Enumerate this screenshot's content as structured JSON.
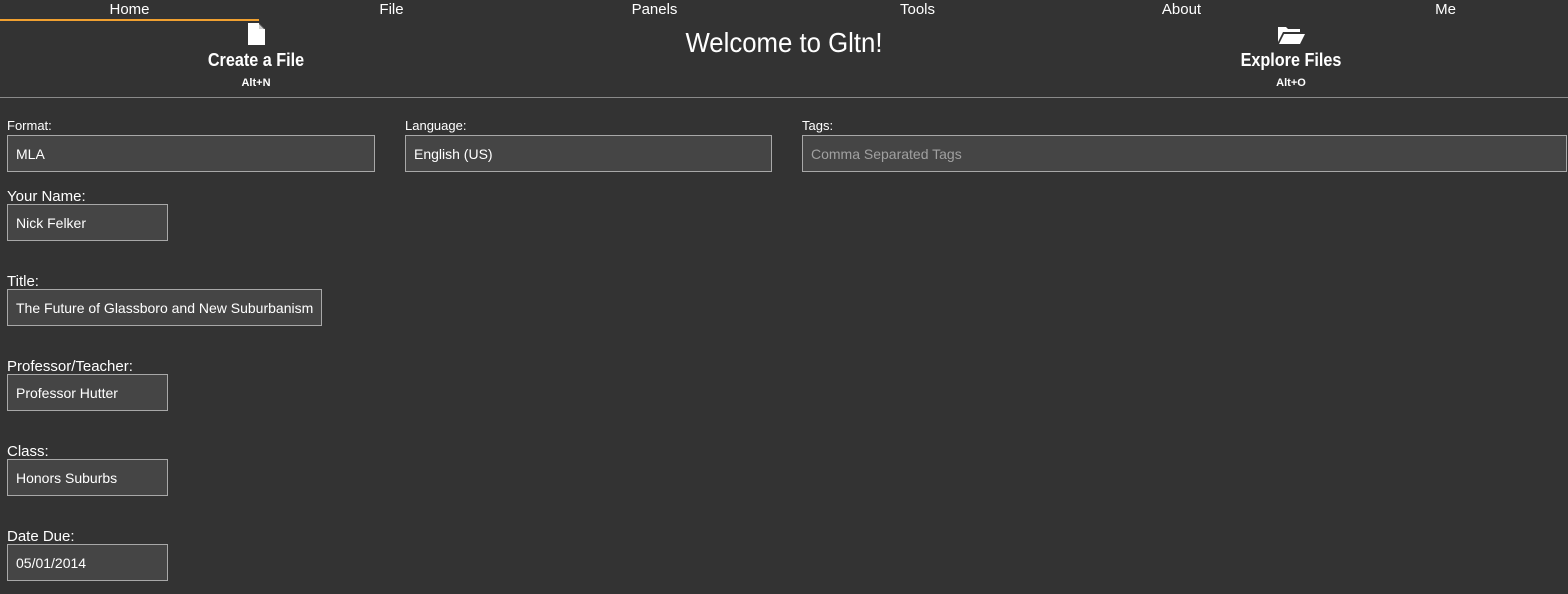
{
  "nav": {
    "tabs": [
      "Home",
      "File",
      "Panels",
      "Tools",
      "About",
      "Me"
    ],
    "active": "Home"
  },
  "header": {
    "create": {
      "label": "Create a File",
      "shortcut": "Alt+N",
      "icon": "file-icon"
    },
    "welcome": "Welcome to Gltn!",
    "explore": {
      "label": "Explore Files",
      "shortcut": "Alt+O",
      "icon": "folder-open-icon"
    }
  },
  "form": {
    "format": {
      "label": "Format:",
      "value": "MLA"
    },
    "language": {
      "label": "Language:",
      "value": "English (US)"
    },
    "tags": {
      "label": "Tags:",
      "value": "",
      "placeholder": "Comma Separated Tags"
    },
    "name": {
      "label": "Your Name:",
      "value": "Nick Felker"
    },
    "title": {
      "label": "Title:",
      "value": "The Future of Glassboro and New Suburbanism"
    },
    "professor": {
      "label": "Professor/Teacher:",
      "value": "Professor Hutter"
    },
    "class": {
      "label": "Class:",
      "value": "Honors Suburbs"
    },
    "date_due": {
      "label": "Date Due:",
      "value": "05/01/2014"
    }
  },
  "colors": {
    "background": "#333333",
    "accent": "#f0a030",
    "input_background": "#454545",
    "input_border": "#a8a8a8"
  }
}
